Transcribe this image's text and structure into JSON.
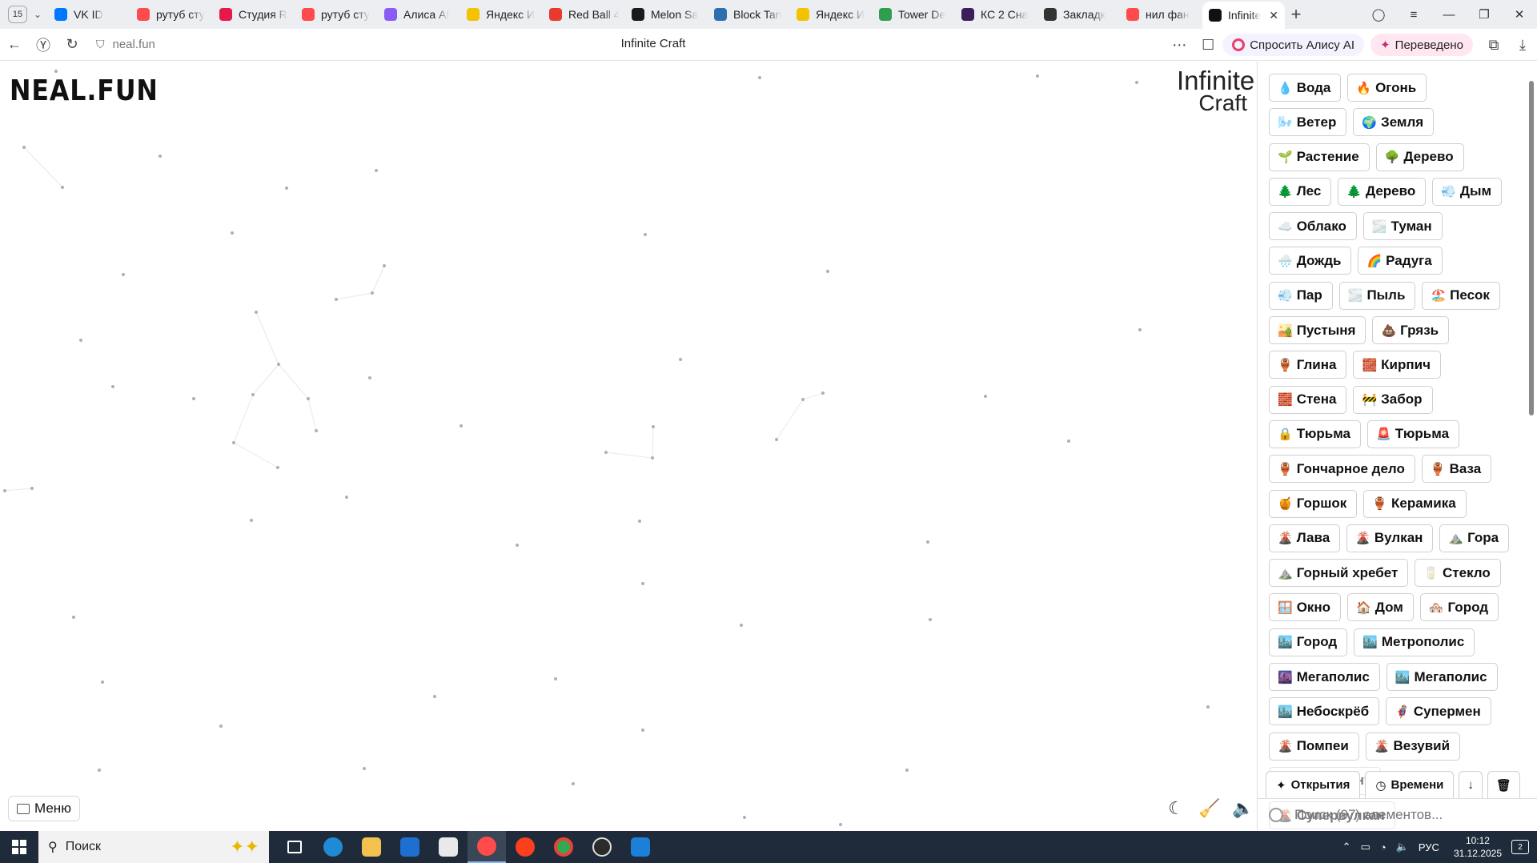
{
  "browser": {
    "tab_count": "15",
    "tabs": [
      {
        "title": "VK ID",
        "color": "#0077ff"
      },
      {
        "title": "рутуб сту",
        "color": "#ff4b4b"
      },
      {
        "title": "Студия R",
        "color": "#e6194b"
      },
      {
        "title": "рутуб сту",
        "color": "#ff4b4b"
      },
      {
        "title": "Алиса AI",
        "color": "#8a5cf6"
      },
      {
        "title": "Яндекс И",
        "color": "#f3c200"
      },
      {
        "title": "Red Ball 4",
        "color": "#e63b2e"
      },
      {
        "title": "Melon Sa",
        "color": "#1a1a1a"
      },
      {
        "title": "Block Tan",
        "color": "#2f6fb0"
      },
      {
        "title": "Яндекс И",
        "color": "#f3c200"
      },
      {
        "title": "Tower De",
        "color": "#2e9e4f"
      },
      {
        "title": "КС 2 Сна",
        "color": "#3b1f5a"
      },
      {
        "title": "Закладк",
        "color": "#333333"
      },
      {
        "title": "нил фан",
        "color": "#ff4b4b"
      },
      {
        "title": "Infinite",
        "color": "#111111",
        "active": true
      }
    ],
    "url": "neal.fun",
    "page_title": "Infinite Craft",
    "ask_alice": "Спросить Алису AI",
    "translated": "Переведено"
  },
  "page": {
    "logo": "NEAL.FUN",
    "title_line1": "Infinite",
    "title_line2": "Craft",
    "menu_label": "Меню"
  },
  "sidebar": {
    "items": [
      {
        "emoji": "💧",
        "label": "Вода"
      },
      {
        "emoji": "🔥",
        "label": "Огонь"
      },
      {
        "emoji": "🌬️",
        "label": "Ветер"
      },
      {
        "emoji": "🌍",
        "label": "Земля"
      },
      {
        "emoji": "🌱",
        "label": "Растение"
      },
      {
        "emoji": "🌳",
        "label": "Дерево"
      },
      {
        "emoji": "🌲",
        "label": "Лес"
      },
      {
        "emoji": "🌲",
        "label": "Дерево"
      },
      {
        "emoji": "💨",
        "label": "Дым"
      },
      {
        "emoji": "☁️",
        "label": "Облако"
      },
      {
        "emoji": "🌫️",
        "label": "Туман"
      },
      {
        "emoji": "🌧️",
        "label": "Дождь"
      },
      {
        "emoji": "🌈",
        "label": "Радуга"
      },
      {
        "emoji": "💨",
        "label": "Пар"
      },
      {
        "emoji": "🌫️",
        "label": "Пыль"
      },
      {
        "emoji": "🏖️",
        "label": "Песок"
      },
      {
        "emoji": "🏜️",
        "label": "Пустыня"
      },
      {
        "emoji": "💩",
        "label": "Грязь"
      },
      {
        "emoji": "🏺",
        "label": "Глина"
      },
      {
        "emoji": "🧱",
        "label": "Кирпич"
      },
      {
        "emoji": "🧱",
        "label": "Стена"
      },
      {
        "emoji": "🚧",
        "label": "Забор"
      },
      {
        "emoji": "🔒",
        "label": "Тюрьма"
      },
      {
        "emoji": "🚨",
        "label": "Тюрьма"
      },
      {
        "emoji": "🏺",
        "label": "Гончарное дело"
      },
      {
        "emoji": "🏺",
        "label": "Ваза"
      },
      {
        "emoji": "🍯",
        "label": "Горшок"
      },
      {
        "emoji": "🏺",
        "label": "Керамика"
      },
      {
        "emoji": "🌋",
        "label": "Лава"
      },
      {
        "emoji": "🌋",
        "label": "Вулкан"
      },
      {
        "emoji": "⛰️",
        "label": "Гора"
      },
      {
        "emoji": "⛰️",
        "label": "Горный хребет"
      },
      {
        "emoji": "🥛",
        "label": "Стекло"
      },
      {
        "emoji": "🪟",
        "label": "Окно"
      },
      {
        "emoji": "🏠",
        "label": "Дом"
      },
      {
        "emoji": "🏘️",
        "label": "Город"
      },
      {
        "emoji": "🏙️",
        "label": "Город"
      },
      {
        "emoji": "🏙️",
        "label": "Метрополис"
      },
      {
        "emoji": "🌆",
        "label": "Мегаполис"
      },
      {
        "emoji": "🏙️",
        "label": "Мегаполис"
      },
      {
        "emoji": "🏙️",
        "label": "Небоскрёб"
      },
      {
        "emoji": "🦸",
        "label": "Супермен"
      },
      {
        "emoji": "🌋",
        "label": "Помпеи"
      },
      {
        "emoji": "🌋",
        "label": "Везувий"
      },
      {
        "emoji": "🏢",
        "label": "Кларк Кент",
        "faded": true
      },
      {
        "emoji": "🌋",
        "label": "Супервулкан",
        "faded": true
      }
    ],
    "sort_discoveries": "Открытия",
    "sort_time": "Времени",
    "sort_direction": "↓",
    "search_placeholder": "Поиск (97) элементов..."
  },
  "taskbar": {
    "search_label": "Поиск",
    "language": "РУС",
    "time": "10:12",
    "date": "31.12.2025",
    "notifications": "2"
  }
}
